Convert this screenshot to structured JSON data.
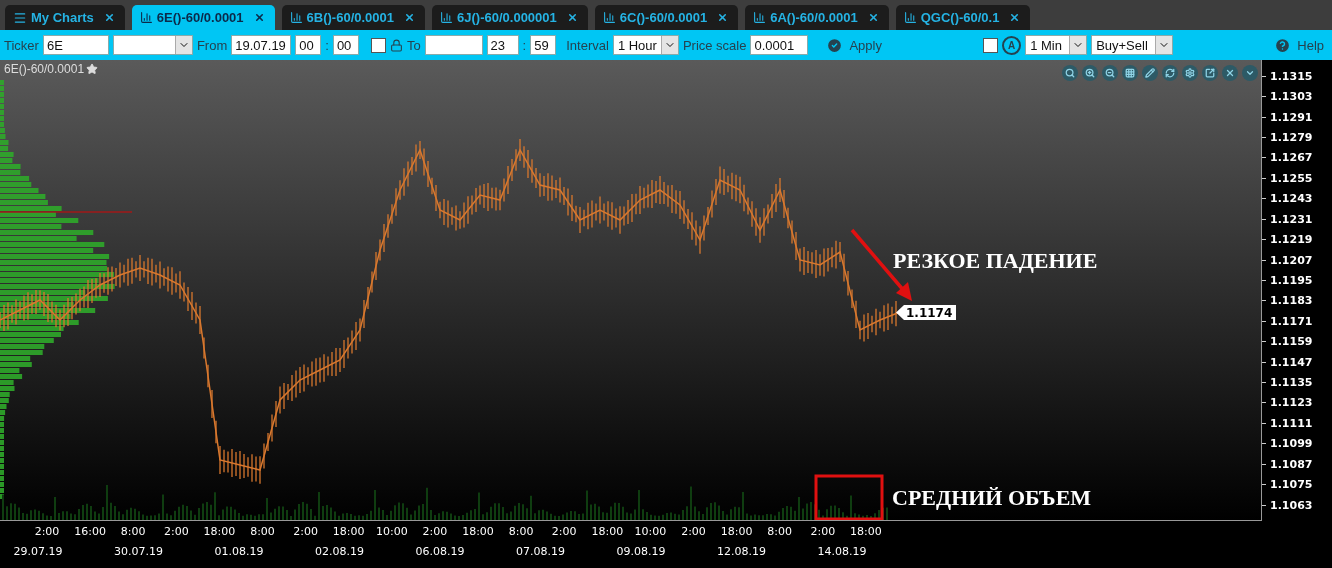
{
  "tabs": [
    {
      "label": "My Charts",
      "kind": "menu",
      "selected": false
    },
    {
      "label": "6E()-60/0.0001",
      "kind": "chart",
      "selected": true
    },
    {
      "label": "6B()-60/0.0001",
      "kind": "chart",
      "selected": false
    },
    {
      "label": "6J()-60/0.000001",
      "kind": "chart",
      "selected": false
    },
    {
      "label": "6C()-60/0.0001",
      "kind": "chart",
      "selected": false
    },
    {
      "label": "6A()-60/0.0001",
      "kind": "chart",
      "selected": false
    },
    {
      "label": "QGC()-60/0.1",
      "kind": "chart",
      "selected": false
    }
  ],
  "toolbar": {
    "ticker": {
      "label": "Ticker",
      "value": "6E"
    },
    "from": {
      "label": "From",
      "date": "19.07.19",
      "hour": "00",
      "separator": ":",
      "minute": "00"
    },
    "lock": {
      "checked": false
    },
    "to": {
      "label": "To",
      "hour": "23",
      "separator": ":",
      "minute": "59"
    },
    "interval": {
      "label": "Interval",
      "value": "1 Hour"
    },
    "price_scale": {
      "label": "Price scale",
      "value": "0.0001"
    },
    "apply": "Apply",
    "auto": {
      "checked": false,
      "letter": "A"
    },
    "resolution": "1 Min",
    "side": "Buy+Sell",
    "help": "Help"
  },
  "chart": {
    "title": "6E()-60/0.0001",
    "last_price": "1.1174",
    "notes": [
      "РЕЗКОЕ ПАДЕНИЕ",
      "СРЕДНИЙ ОБЪЕМ"
    ],
    "price_axis": [
      "1.1315",
      "1.1303",
      "1.1291",
      "1.1279",
      "1.1267",
      "1.1255",
      "1.1243",
      "1.1231",
      "1.1219",
      "1.1207",
      "1.1195",
      "1.1183",
      "1.1171",
      "1.1159",
      "1.1147",
      "1.1135",
      "1.1123",
      "1.1111",
      "1.1099",
      "1.1087",
      "1.1075",
      "1.1063"
    ],
    "time_axis": [
      "2:00",
      "16:00",
      "8:00",
      "2:00",
      "18:00",
      "8:00",
      "2:00",
      "18:00",
      "10:00",
      "2:00",
      "18:00",
      "8:00",
      "2:00",
      "18:00",
      "10:00",
      "2:00",
      "18:00",
      "8:00",
      "2:00",
      "18:00"
    ],
    "date_axis": [
      "29.07.19",
      "30.07.19",
      "01.08.19",
      "02.08.19",
      "06.08.19",
      "07.08.19",
      "09.08.19",
      "12.08.19",
      "14.08.19"
    ]
  }
}
